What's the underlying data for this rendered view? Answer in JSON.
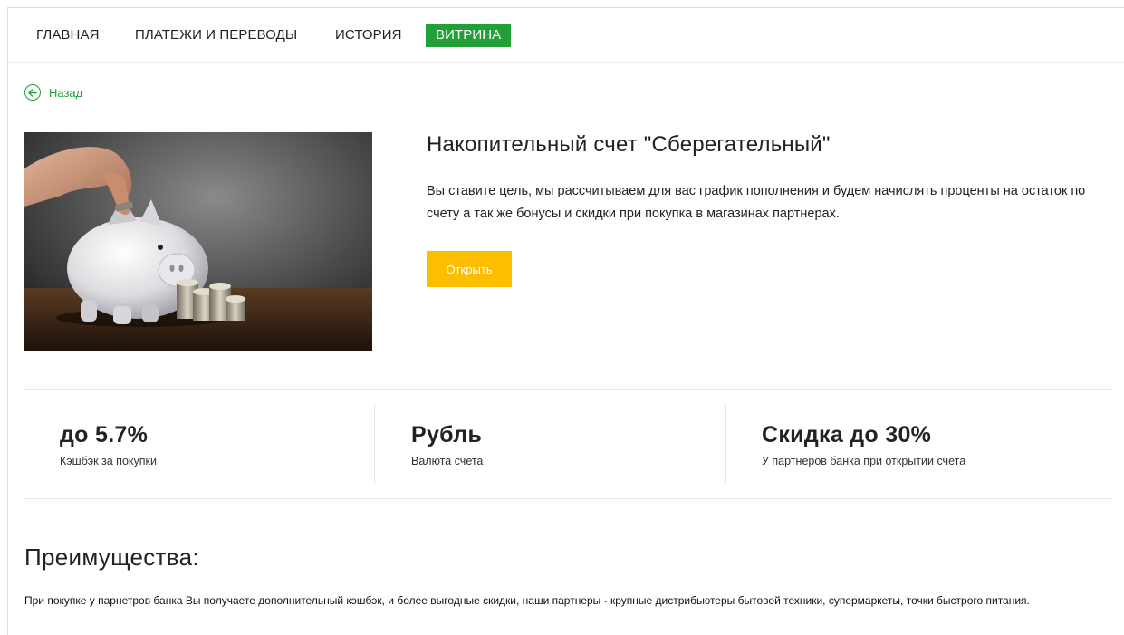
{
  "nav": {
    "items": [
      {
        "label": "ГЛАВНАЯ"
      },
      {
        "label": "ПЛАТЕЖИ И ПЕРЕВОДЫ"
      },
      {
        "label": "ИСТОРИЯ"
      },
      {
        "label": "ВИТРИНА"
      }
    ],
    "active_item": "ВИТРИНА"
  },
  "back": {
    "label": "Назад",
    "icon": "arrow-left-circle-icon"
  },
  "product": {
    "title": "Накопительный счет \"Сберегательный\"",
    "description": "Вы ставите цель, мы рассчитываем для вас график пополнения и будем начислять проценты на остаток по счету а так же бонусы и скидки при покупка в магазинах партнерах.",
    "open_label": "Открыть"
  },
  "stats": [
    {
      "value": "до 5.7%",
      "label": "Кэшбэк за покупки"
    },
    {
      "value": "Рубль",
      "label": "Валюта счета"
    },
    {
      "value": "Скидка до 30%",
      "label": "У партнеров банка при открытии счета"
    }
  ],
  "advantages": {
    "title": "Преимущества:",
    "text": "При покупке у парнетров банка Вы получаете дополнительный кэшбэк, и более выгодные скидки, наши партнеры - крупные дистрибьютеры бытовой техники, супермаркеты, точки быстрого питания."
  },
  "colors": {
    "accent": "#21a038",
    "button": "#fdbd00",
    "text": "#222222",
    "divider": "#e8e8e8"
  }
}
